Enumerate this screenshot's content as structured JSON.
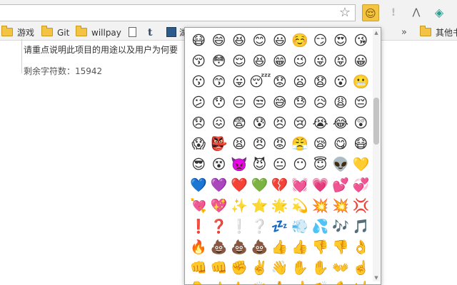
{
  "toolbar": {
    "star_glyph": "☆",
    "extensions": [
      {
        "name": "emoji-extension",
        "glyph": "😌"
      },
      {
        "name": "warning-extension",
        "glyph": "!"
      },
      {
        "name": "network-extension",
        "glyph": "⋀"
      },
      {
        "name": "diamond-extension",
        "glyph": "◈"
      }
    ]
  },
  "bookmarks": {
    "items": [
      {
        "label": "游戏",
        "icon": "folder-icon"
      },
      {
        "label": "Git",
        "icon": "folder-icon"
      },
      {
        "label": "willpay",
        "icon": "folder-icon"
      },
      {
        "label": "",
        "icon": "page-icon"
      },
      {
        "label": "t",
        "icon": "tumblr-icon"
      },
      {
        "label": "湖",
        "icon": "film-icon"
      }
    ],
    "more": "»",
    "other_label": "其他书"
  },
  "content": {
    "hint": "请重点说明此项目的用途以及用户为何要",
    "remaining_label": "剩余字符数：",
    "remaining_count": "15942"
  },
  "emoji_rows": [
    [
      "😷",
      "😄",
      "😆",
      "😊",
      "😃",
      "☺️",
      "😏",
      "😍",
      "😘"
    ],
    [
      "😚",
      "😳",
      "😌",
      "😆",
      "😁",
      "😉",
      "😜",
      "😝",
      "😀"
    ],
    [
      "😗",
      "😙",
      "😛",
      "😴",
      "😟",
      "😦",
      "😧",
      "😮",
      "😬"
    ],
    [
      "😕",
      "😯",
      "😑",
      "😒",
      "😅",
      "😓",
      "😥",
      "😩",
      "😔"
    ],
    [
      "😞",
      "😖",
      "😨",
      "😰",
      "😣",
      "😢",
      "😭",
      "😂",
      "😲"
    ],
    [
      "😱",
      "👺",
      "😫",
      "😠",
      "😡",
      "😤",
      "😪",
      "😋",
      "😷"
    ],
    [
      "😎",
      "😵",
      "👿",
      "😈",
      "😐",
      "😶",
      "😇",
      "👽",
      "💛"
    ],
    [
      "💙",
      "💜",
      "❤️",
      "💚",
      "💔",
      "💓",
      "💗",
      "💕",
      "💞"
    ],
    [
      "💘",
      "💖",
      "✨",
      "⭐",
      "🌟",
      "💫",
      "💥",
      "💥",
      "💢"
    ],
    [
      "❗",
      "❓",
      "❕",
      "❔",
      "💤",
      "💨",
      "💦",
      "🎶",
      "🎵"
    ],
    [
      "🔥",
      "💩",
      "💩",
      "💩",
      "👍",
      "👍",
      "👎",
      "👎",
      "👌"
    ],
    [
      "👊",
      "👊",
      "✊",
      "✌️",
      "👋",
      "✋",
      "✋",
      "👐",
      "☝️"
    ],
    [
      "👇",
      "👈",
      "👉",
      "🙌",
      "🙏",
      "☝️",
      "👏",
      "💪",
      "🤘"
    ]
  ]
}
